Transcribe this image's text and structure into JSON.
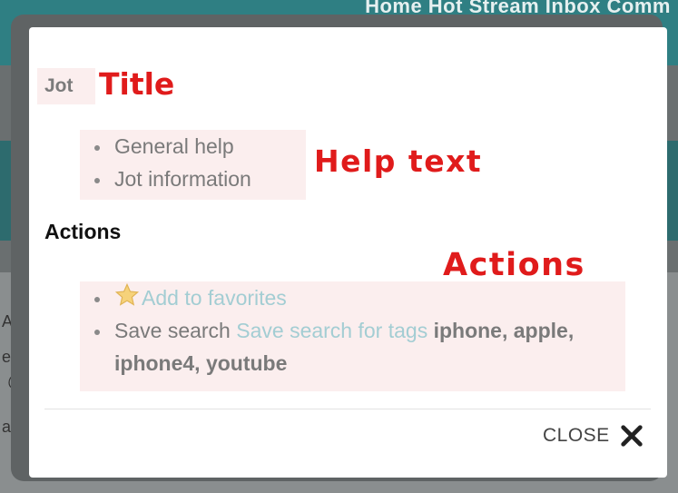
{
  "background": {
    "topnav": "Home   Hot Stream   Inbox   Comm",
    "fragments": [
      "Ap",
      "ea",
      "@",
      "ap"
    ]
  },
  "modal": {
    "jot_label": "Jot",
    "help_items": [
      "General help",
      "Jot information"
    ],
    "actions_heading": "Actions",
    "actions": {
      "favorites_link": "Add to favorites",
      "save_search_label": "Save search",
      "save_search_link": "Save search for tags",
      "tags": "iphone, apple, iphone4, youtube"
    },
    "close_label": "CLOSE",
    "close_icon": "close-x-icon",
    "favorite_icon": "star-icon"
  },
  "annotations": {
    "title": "Title",
    "help_text": "Help text",
    "actions": "Actions"
  },
  "colors": {
    "annotation": "#e01b1b",
    "link": "#a3cdd3",
    "highlight": "#fbeeee",
    "topbar": "#2f7f83"
  }
}
